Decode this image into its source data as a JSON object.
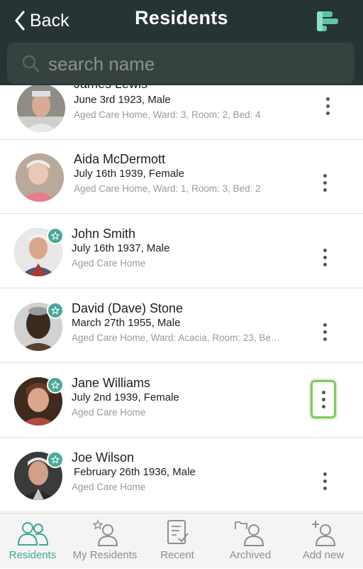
{
  "header": {
    "back_label": "Back",
    "title": "Residents"
  },
  "search": {
    "placeholder": "search name"
  },
  "residents": [
    {
      "name": "James Lewis",
      "dob": "June 3rd 1923, Male",
      "location": "Aged Care Home, Ward: 3, Room: 2, Bed: 4",
      "starred": false
    },
    {
      "name": "Aida McDermott",
      "dob": "July 16th 1939, Female",
      "location": "Aged Care Home, Ward: 1, Room: 3, Bed: 2",
      "starred": false
    },
    {
      "name": "John Smith",
      "dob": "July 16th 1937, Male",
      "location": "Aged Care Home",
      "starred": true
    },
    {
      "name": "David (Dave) Stone",
      "dob": "March 27th 1955, Male",
      "location": "Aged Care Home, Ward: Acacia, Room: 23, Be…",
      "starred": true
    },
    {
      "name": "Jane Williams",
      "dob": "July 2nd 1939, Female",
      "location": "Aged Care Home",
      "starred": true,
      "menu_highlighted": true
    },
    {
      "name": "Joe Wilson",
      "dob": "February 26th 1936, Male",
      "location": "Aged Care Home",
      "starred": true
    }
  ],
  "tabs": [
    {
      "label": "Residents",
      "icon": "residents-icon",
      "active": true
    },
    {
      "label": "My Residents",
      "icon": "my-residents-icon",
      "active": false
    },
    {
      "label": "Recent",
      "icon": "recent-icon",
      "active": false
    },
    {
      "label": "Archived",
      "icon": "archived-icon",
      "active": false
    },
    {
      "label": "Add new",
      "icon": "add-new-icon",
      "active": false
    }
  ],
  "colors": {
    "header_bg": "#263533",
    "accent": "#3ba89d",
    "badge": "#49a99a",
    "highlight": "#7ecb58"
  }
}
